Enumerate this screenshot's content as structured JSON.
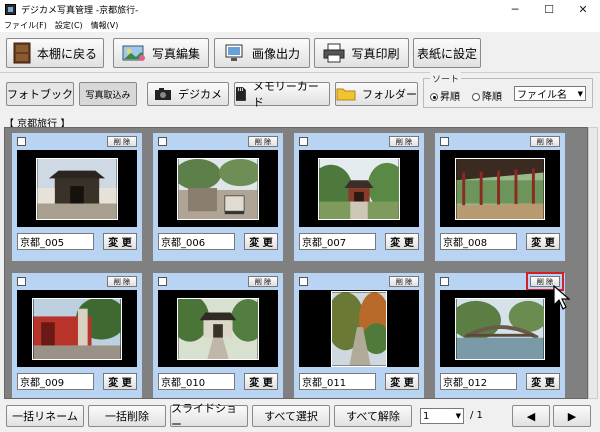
{
  "window": {
    "title": "デジカメ写真管理 -京都旅行-",
    "minimize": "─",
    "maximize": "☐",
    "close": "✕"
  },
  "menu": [
    "ファイル(F)",
    "設定(C)",
    "情報(V)"
  ],
  "toolbar": {
    "back": "本棚に戻る",
    "edit": "写真編集",
    "output": "画像出力",
    "print": "写真印刷",
    "cover": "表紙に設定"
  },
  "sources": {
    "photobook": "フォトブック",
    "import": "写真取込み",
    "camera": "デジカメ",
    "memory": "メモリーカード",
    "folder": "フォルダー"
  },
  "sort": {
    "label": "ソート",
    "asc": "昇順",
    "desc": "降順",
    "key": "ファイル名"
  },
  "album": {
    "label": "【 京都旅行 】"
  },
  "cards": [
    {
      "name": "京都_005",
      "delete": "削 除",
      "change": "変 更"
    },
    {
      "name": "京都_006",
      "delete": "削 除",
      "change": "変 更"
    },
    {
      "name": "京都_007",
      "delete": "削 除",
      "change": "変 更"
    },
    {
      "name": "京都_008",
      "delete": "削 除",
      "change": "変 更"
    },
    {
      "name": "京都_009",
      "delete": "削 除",
      "change": "変 更"
    },
    {
      "name": "京都_010",
      "delete": "削 除",
      "change": "変 更"
    },
    {
      "name": "京都_011",
      "delete": "削 除",
      "change": "変 更"
    },
    {
      "name": "京都_012",
      "delete": "削 除",
      "change": "変 更"
    }
  ],
  "bottom": {
    "rename": "一括リネーム",
    "delete_all": "一括削除",
    "slideshow": "スライドショー",
    "select_all": "すべて選択",
    "deselect_all": "すべて解除",
    "page": "1",
    "total": "/ 1",
    "prev": "◀",
    "next": "▶"
  }
}
